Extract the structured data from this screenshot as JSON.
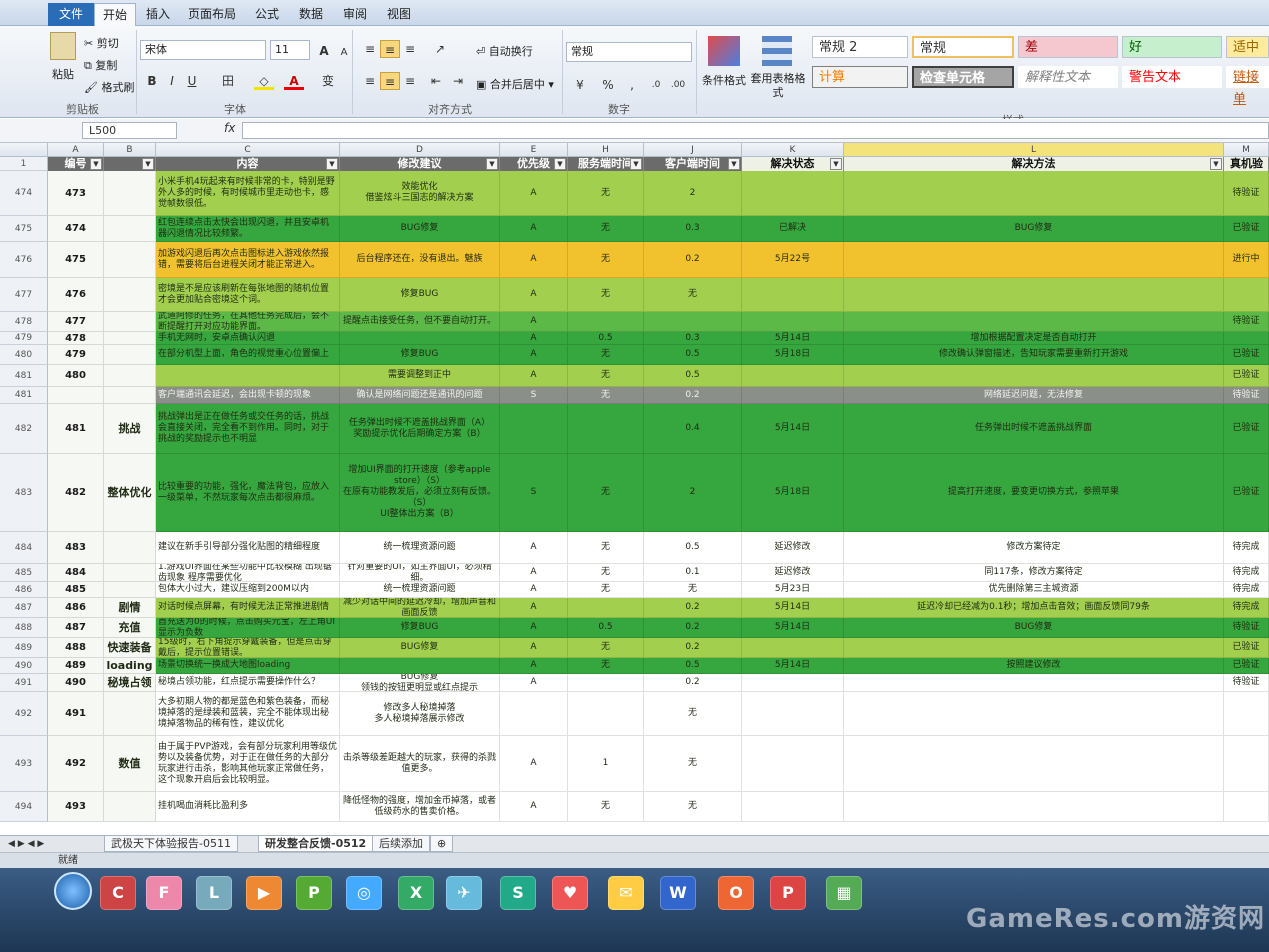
{
  "ribbon_tabs": [
    "文件",
    "开始",
    "插入",
    "页面布局",
    "公式",
    "数据",
    "审阅",
    "视图"
  ],
  "clipboard": {
    "paste": "粘贴",
    "cut": "剪切",
    "copy": "复制",
    "format_painter": "格式刷",
    "group": "剪贴板"
  },
  "font": {
    "name": "宋体",
    "size": "11",
    "grow": "A",
    "shrink": "A",
    "bold": "B",
    "italic": "I",
    "underline": "U",
    "border": "田",
    "fill": "◇",
    "color": "A",
    "phonetic": "变",
    "group": "字体"
  },
  "alignment": {
    "wrap": "自动换行",
    "merge": "合并后居中",
    "group": "对齐方式"
  },
  "number": {
    "format": "常规",
    "percent": "%",
    "comma": ",",
    "group": "数字"
  },
  "styles_group": {
    "conditional": "条件格式",
    "table": "套用表格格式",
    "group": "样式",
    "cells": [
      {
        "label": "常规 2"
      },
      {
        "label": "常规"
      },
      {
        "label": "差"
      },
      {
        "label": "好"
      },
      {
        "label": "适中"
      },
      {
        "label": "计算"
      },
      {
        "label": "检查单元格"
      },
      {
        "label": "解释性文本"
      },
      {
        "label": "警告文本"
      },
      {
        "label": "链接单"
      }
    ]
  },
  "formula_bar": {
    "name_box": "L500",
    "fx": "fx"
  },
  "col_letters": [
    "A",
    "B",
    "C",
    "D",
    "E",
    "H",
    "J",
    "K",
    "L",
    "M"
  ],
  "header": {
    "num": "编号",
    "content": "内容",
    "suggest": "修改建议",
    "priority": "优先级",
    "server": "服务端时间",
    "client": "客户端时间",
    "status": "解决状态",
    "method": "解决方法",
    "verify": "真机验"
  },
  "rows": [
    {
      "rn": "474",
      "num": "473",
      "mod": "",
      "content": "小米手机4玩起来有时候非常的卡，特别是野外人多的时候，有时候城市里走动也卡，感觉帧数很低。",
      "suggest": "效能优化\n借鉴炫斗三国志的解决方案",
      "prio": "A",
      "server": "无",
      "client": "2",
      "status": "",
      "method": "",
      "verify": "待验证",
      "bg": "#a3cf4f"
    },
    {
      "rn": "475",
      "num": "474",
      "mod": "",
      "content": "红包连续点击太快会出现闪退，并且安卓机器闪退情况比较频繁。",
      "suggest": "BUG修复",
      "prio": "A",
      "server": "无",
      "client": "0.3",
      "status": "已解决",
      "method": "BUG修复",
      "verify": "已验证",
      "bg": "#36a63e"
    },
    {
      "rn": "476",
      "num": "475",
      "mod": "",
      "content": "加游戏闪退后再次点击图标进入游戏依然报错，需要将后台进程关闭才能正常进入。",
      "suggest": "后台程序还在，没有退出。魅族",
      "prio": "A",
      "server": "无",
      "client": "0.2",
      "status": "5月22号",
      "method": "",
      "verify": "进行中",
      "bg": "#f2c12e"
    },
    {
      "rn": "477",
      "num": "476",
      "mod": "",
      "content": "密境是不是应该刷新在每张地图的随机位置才会更加贴合密境这个词。",
      "suggest": "修复BUG",
      "prio": "A",
      "server": "无",
      "client": "无",
      "status": "",
      "method": "",
      "verify": "",
      "bg": "#a3cf4f"
    },
    {
      "rn": "478",
      "num": "477",
      "mod": "",
      "content": "武道阿修的任务，在其他任务完成后，会不断提醒打开对应功能界面。",
      "suggest": "提醒点击接受任务，但不要自动打开。",
      "prio": "A",
      "server": "",
      "client": "",
      "status": "",
      "method": "",
      "verify": "待验证",
      "bg": "#5cb847"
    },
    {
      "rn": "479",
      "num": "478",
      "mod": "",
      "content": "手机无网时，安卓点确认闪退",
      "suggest": "",
      "prio": "A",
      "server": "0.5",
      "client": "0.3",
      "status": "5月14日",
      "method": "增加根据配置决定是否自动打开",
      "verify": "",
      "bg": "#36a63e"
    },
    {
      "rn": "480",
      "num": "479",
      "mod": "",
      "content": "在部分机型上面，角色的视觉重心位置偏上",
      "suggest": "修复BUG",
      "prio": "A",
      "server": "无",
      "client": "0.5",
      "status": "5月18日",
      "method": "修改确认弹窗描述，告知玩家需要重新打开游戏",
      "verify": "已验证",
      "bg": "#36a63e"
    },
    {
      "rn": "481",
      "num": "480",
      "mod": "",
      "content": "",
      "suggest": "需要调整到正中",
      "prio": "A",
      "server": "无",
      "client": "0.5",
      "status": "",
      "method": "",
      "verify": "已验证",
      "bg": "#a3cf4f"
    },
    {
      "rn": "481",
      "num": "",
      "mod": "",
      "content": "客户端通讯会延迟，会出现卡顿的现象",
      "suggest": "确认是网络问题还是通讯的问题",
      "prio": "S",
      "server": "无",
      "client": "0.2",
      "status": "",
      "method": "网络延迟问题，无法修复",
      "verify": "待验证",
      "bg": "#8b8f8a"
    },
    {
      "rn": "482",
      "num": "481",
      "mod": "挑战",
      "content": "挑战弹出是正在做任务或交任务的话，挑战会直接关闭，完全看不到作用。同时，对于挑战的奖励提示也不明显",
      "suggest": "任务弹出时候不遮盖挑战界面（A）\n奖励提示优化后期确定方案（B）",
      "prio": "",
      "server": "",
      "client": "0.4",
      "status": "5月14日",
      "method": "任务弹出时候不遮盖挑战界面",
      "verify": "已验证",
      "bg": "#36a63e"
    },
    {
      "rn": "483",
      "num": "482",
      "mod": "整体优化",
      "content": "比较重要的功能，强化，魔法背包，应放入一级菜单，不然玩家每次点击都很麻烦。",
      "suggest": "增加UI界面的打开速度（参考apple store）（S）\n在原有功能教发后，必须立刻有反馈。（S）\nUI整体出方案（B）",
      "prio": "S",
      "server": "无",
      "client": "2",
      "status": "5月18日",
      "method": "提高打开速度，要变更切换方式，参照苹果",
      "verify": "已验证",
      "bg": "#36a63e"
    },
    {
      "rn": "484",
      "num": "483",
      "mod": "",
      "content": "建议在新手引导部分强化贴图的精细程度",
      "suggest": "统一梳理资源问题",
      "prio": "A",
      "server": "无",
      "client": "0.5",
      "status": "延迟修改",
      "method": "修改方案待定",
      "verify": "待完成",
      "bg": "#ffffff"
    },
    {
      "rn": "485",
      "num": "484",
      "mod": "",
      "content": "1.游戏UI界面在某些功能中比较模糊 出现锯齿现象 程序需要优化",
      "suggest": "针对重要的UI，如主界面UI，必须精细。",
      "prio": "A",
      "server": "无",
      "client": "0.1",
      "status": "延迟修改",
      "method": "同117条，修改方案待定",
      "verify": "待完成",
      "bg": "#ffffff"
    },
    {
      "rn": "486",
      "num": "485",
      "mod": "",
      "content": "包体大小过大，建议压缩到200M以内",
      "suggest": "统一梳理资源问题",
      "prio": "A",
      "server": "无",
      "client": "无",
      "status": "5月23日",
      "method": "优先删除第三主城资源",
      "verify": "待完成",
      "bg": "#ffffff"
    },
    {
      "rn": "487",
      "num": "486",
      "mod": "剧情",
      "content": "对话时候点屏幕，有时候无法正常推进剧情",
      "suggest": "减少对话中间的延迟冷却，增加声音和画面反馈",
      "prio": "A",
      "server": "",
      "client": "0.2",
      "status": "5月14日",
      "method": "延迟冷却已经减为0.1秒；增加点击音效；画面反馈同79条",
      "verify": "待完成",
      "bg": "#a3cf4f"
    },
    {
      "rn": "488",
      "num": "487",
      "mod": "充值",
      "content": "首充送为0的时候，点击购买元宝，左上角UI显示为负数",
      "suggest": "修复BUG",
      "prio": "A",
      "server": "0.5",
      "client": "0.2",
      "status": "5月14日",
      "method": "BUG修复",
      "verify": "待验证",
      "bg": "#36a63e"
    },
    {
      "rn": "489",
      "num": "488",
      "mod": "快速装备",
      "content": "15级时，右下角提示穿戴装备，但是点击穿戴后，提示位置错误。",
      "suggest": "BUG修复",
      "prio": "A",
      "server": "无",
      "client": "0.2",
      "status": "",
      "method": "",
      "verify": "已验证",
      "bg": "#a3cf4f"
    },
    {
      "rn": "490",
      "num": "489",
      "mod": "loading",
      "content": "场景切换统一换成大地图loading",
      "suggest": "",
      "prio": "A",
      "server": "无",
      "client": "0.5",
      "status": "5月14日",
      "method": "按照建议修改",
      "verify": "已验证",
      "bg": "#36a63e"
    },
    {
      "rn": "491",
      "num": "490",
      "mod": "秘境占领",
      "content": "秘境占领功能，红点提示需要操作什么？",
      "suggest": "BUG修复\n领钱的按钮更明显或红点提示",
      "prio": "A",
      "server": "",
      "client": "0.2",
      "status": "",
      "method": "",
      "verify": "待验证",
      "bg": "#ffffff"
    },
    {
      "rn": "492",
      "num": "491",
      "mod": "",
      "content": "大多初期人物的都是蓝色和紫色装备，而秘境掉落的是绿装和蓝装，完全不能体现出秘境掉落物品的稀有性，建议优化",
      "suggest": "修改多人秘境掉落\n多人秘境掉落展示修改",
      "prio": "",
      "server": "",
      "client": "无",
      "status": "",
      "method": "",
      "verify": "",
      "bg": "#ffffff"
    },
    {
      "rn": "493",
      "num": "492",
      "mod": "数值",
      "content": "由于属于PVP游戏，会有部分玩家利用等级优势以及装备优势，对于正在做任务的大部分玩家进行击杀，影响其他玩家正常做任务，这个现象开启后会比较明显。",
      "suggest": "击杀等级差距越大的玩家，获得的杀戮值更多。",
      "prio": "A",
      "server": "1",
      "client": "无",
      "status": "",
      "method": "",
      "verify": "",
      "bg": "#ffffff"
    },
    {
      "rn": "494",
      "num": "493",
      "mod": "",
      "content": "挂机喝血消耗比盈利多",
      "suggest": "降低怪物的强度，增加金币掉落，或者低级药水的售卖价格。",
      "prio": "A",
      "server": "无",
      "client": "无",
      "status": "",
      "method": "",
      "verify": "",
      "bg": "#ffffff"
    }
  ],
  "sheet_tabs": [
    "武极天下体验报告-0511",
    "研发整合反馈-0512",
    "后续添加"
  ],
  "status_text": "就绪",
  "taskbar_icons": [
    "C",
    "F",
    "L",
    "▶",
    "P",
    "◎",
    "X",
    "✈",
    "S",
    "♥",
    "✉",
    "W",
    "O",
    "P",
    "▦"
  ],
  "watermark": "GameRes.com游资网"
}
